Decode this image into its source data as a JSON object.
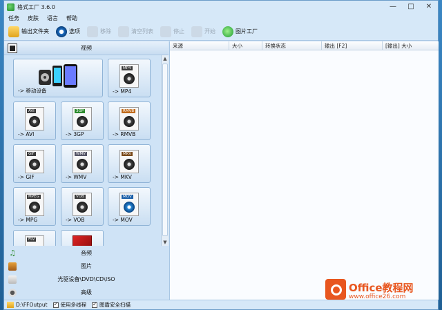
{
  "window": {
    "title": "格式工厂 3.6.0",
    "controls": [
      "—",
      "□",
      "✕"
    ]
  },
  "menu": [
    "任务",
    "皮肤",
    "语言",
    "帮助"
  ],
  "toolbar": [
    {
      "label": "输出文件夹",
      "icon": "folder-icon",
      "enabled": true
    },
    {
      "label": "选项",
      "icon": "options-icon",
      "enabled": true
    },
    {
      "label": "移除",
      "icon": "remove-icon",
      "enabled": false
    },
    {
      "label": "清空列表",
      "icon": "clear-list-icon",
      "enabled": false
    },
    {
      "label": "停止",
      "icon": "stop-icon",
      "enabled": false
    },
    {
      "label": "开始",
      "icon": "start-icon",
      "enabled": false
    },
    {
      "label": "图片工厂",
      "icon": "picture-factory-icon",
      "enabled": true
    }
  ],
  "categories": {
    "video": "视频",
    "audio": "音频",
    "image": "图片",
    "dvd": "光驱设备\\DVD\\CD\\ISO",
    "advanced": "高级"
  },
  "tiles": [
    {
      "label": "-> 移动设备",
      "tag": ""
    },
    {
      "label": "-> MP4",
      "tag": "MP4"
    },
    {
      "label": "-> AVI",
      "tag": "AVI"
    },
    {
      "label": "-> 3GP",
      "tag": "3GP"
    },
    {
      "label": "-> RMVB",
      "tag": "RMVB"
    },
    {
      "label": "-> GIF",
      "tag": "GIF"
    },
    {
      "label": "-> WMV",
      "tag": "WMV"
    },
    {
      "label": "-> MKV",
      "tag": "MKV"
    },
    {
      "label": "-> MPG",
      "tag": "MPEG"
    },
    {
      "label": "-> VOB",
      "tag": "VOB"
    },
    {
      "label": "-> MOV",
      "tag": "MOV"
    },
    {
      "label": "",
      "tag": "FLV"
    },
    {
      "label": "",
      "tag": ""
    }
  ],
  "columns": [
    "来源",
    "大小",
    "转换状态",
    "输出 [F2]",
    "[输出] 大小"
  ],
  "status": {
    "output_path": "D:\\FFOutput",
    "multithread": "使用多线程",
    "safe_scan": "图盾安全扫描"
  },
  "watermark": {
    "title": "Office教程网",
    "url": "www.office26.com"
  }
}
